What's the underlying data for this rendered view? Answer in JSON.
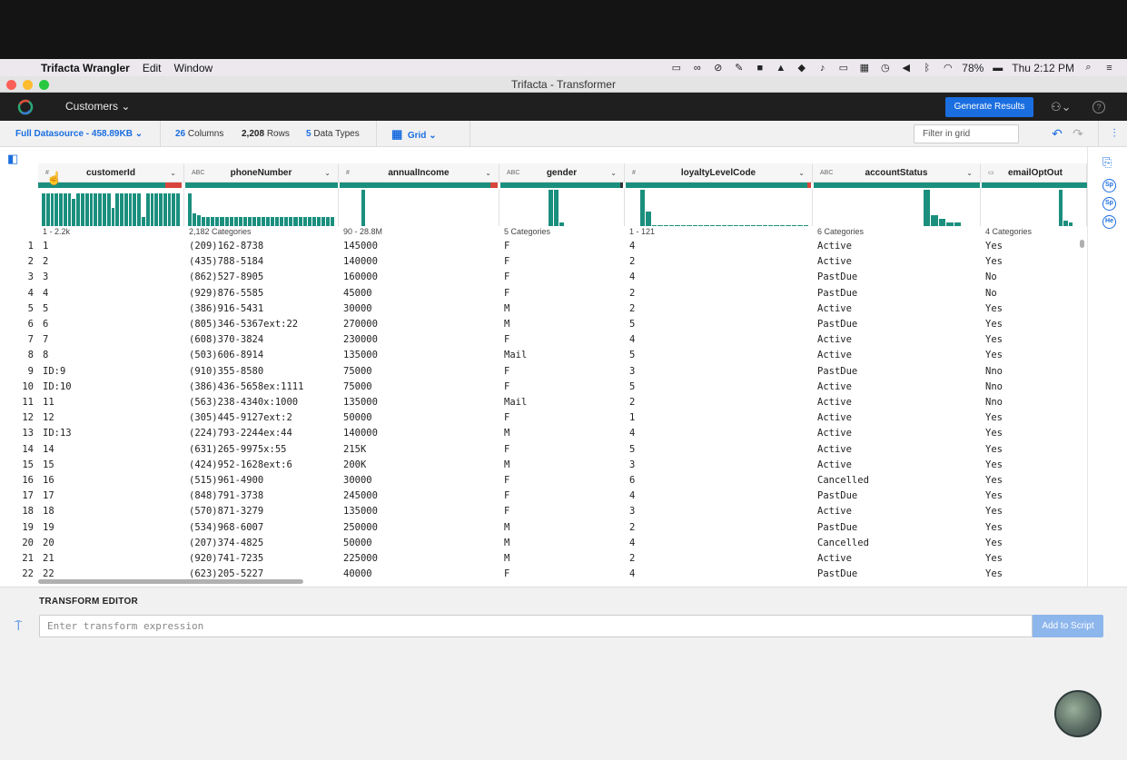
{
  "mac_menu": {
    "app_name": "Trifacta Wrangler",
    "items": [
      "Edit",
      "Window"
    ],
    "battery": "78%",
    "clock": "Thu 2:12 PM"
  },
  "window_title": "Trifacta - Transformer",
  "appbar": {
    "flow_name": "Customers",
    "generate_label": "Generate Results"
  },
  "toolbar": {
    "datasource": "Full Datasource - 458.89KB",
    "columns_count": "26",
    "columns_label": "Columns",
    "rows_count": "2,208",
    "rows_label": "Rows",
    "types_count": "5",
    "types_label": "Data Types",
    "view_label": "Grid",
    "filter_placeholder": "Filter in grid"
  },
  "columns": [
    {
      "name": "customerId",
      "type": "#",
      "summary": "1 - 2.2k"
    },
    {
      "name": "phoneNumber",
      "type": "ABC",
      "summary": "2,182 Categories"
    },
    {
      "name": "annualIncome",
      "type": "#",
      "summary": "90 - 28.8M"
    },
    {
      "name": "gender",
      "type": "ABC",
      "summary": "5 Categories"
    },
    {
      "name": "loyaltyLevelCode",
      "type": "#",
      "summary": "1 - 121"
    },
    {
      "name": "accountStatus",
      "type": "ABC",
      "summary": "6 Categories"
    },
    {
      "name": "emailOptOut",
      "type": "bool",
      "summary": "4 Categories"
    }
  ],
  "rows": [
    [
      "1",
      "(209)162-8738",
      "145000",
      "F",
      "4",
      "Active",
      "Yes"
    ],
    [
      "2",
      "(435)788-5184",
      "140000",
      "F",
      "2",
      "Active",
      "Yes"
    ],
    [
      "3",
      "(862)527-8905",
      "160000",
      "F",
      "4",
      "PastDue",
      "No"
    ],
    [
      "4",
      "(929)876-5585",
      "45000",
      "F",
      "2",
      "PastDue",
      "No"
    ],
    [
      "5",
      "(386)916-5431",
      "30000",
      "M",
      "2",
      "Active",
      "Yes"
    ],
    [
      "6",
      "(805)346-5367ext:22",
      "270000",
      "M",
      "5",
      "PastDue",
      "Yes"
    ],
    [
      "7",
      "(608)370-3824",
      "230000",
      "F",
      "4",
      "Active",
      "Yes"
    ],
    [
      "8",
      "(503)606-8914",
      "135000",
      "Mail",
      "5",
      "Active",
      "Yes"
    ],
    [
      "ID:9",
      "(910)355-8580",
      "75000",
      "F",
      "3",
      "PastDue",
      "Nno"
    ],
    [
      "ID:10",
      "(386)436-5658ex:1111",
      "75000",
      "F",
      "5",
      "Active",
      "Nno"
    ],
    [
      "11",
      "(563)238-4340x:1000",
      "135000",
      "Mail",
      "2",
      "Active",
      "Nno"
    ],
    [
      "12",
      "(305)445-9127ext:2",
      "50000",
      "F",
      "1",
      "Active",
      "Yes"
    ],
    [
      "ID:13",
      "(224)793-2244ex:44",
      "140000",
      "M",
      "4",
      "Active",
      "Yes"
    ],
    [
      "14",
      "(631)265-9975x:55",
      "215K",
      "F",
      "5",
      "Active",
      "Yes"
    ],
    [
      "15",
      "(424)952-1628ext:6",
      "200K",
      "M",
      "3",
      "Active",
      "Yes"
    ],
    [
      "16",
      "(515)961-4900",
      "30000",
      "F",
      "6",
      "Cancelled",
      "Yes"
    ],
    [
      "17",
      "(848)791-3738",
      "245000",
      "F",
      "4",
      "PastDue",
      "Yes"
    ],
    [
      "18",
      "(570)871-3279",
      "135000",
      "F",
      "3",
      "Active",
      "Yes"
    ],
    [
      "19",
      "(534)968-6007",
      "250000",
      "M",
      "2",
      "PastDue",
      "Yes"
    ],
    [
      "20",
      "(207)374-4825",
      "50000",
      "M",
      "4",
      "Cancelled",
      "Yes"
    ],
    [
      "21",
      "(920)741-7235",
      "225000",
      "M",
      "2",
      "Active",
      "Yes"
    ],
    [
      "22",
      "(623)205-5227",
      "40000",
      "F",
      "4",
      "PastDue",
      "Yes"
    ]
  ],
  "row_numbers": [
    "1",
    "2",
    "3",
    "4",
    "5",
    "6",
    "7",
    "8",
    "9",
    "10",
    "11",
    "12",
    "13",
    "14",
    "15",
    "16",
    "17",
    "18",
    "19",
    "20",
    "21",
    "22"
  ],
  "rail": [
    "Sp",
    "Sp",
    "He"
  ],
  "editor": {
    "title": "TRANSFORM EDITOR",
    "placeholder": "Enter transform expression",
    "add_label": "Add to Script"
  },
  "colors": {
    "accent": "#1a6ee0",
    "histogram": "#1b8f7e",
    "mismatch": "#d9453c"
  }
}
